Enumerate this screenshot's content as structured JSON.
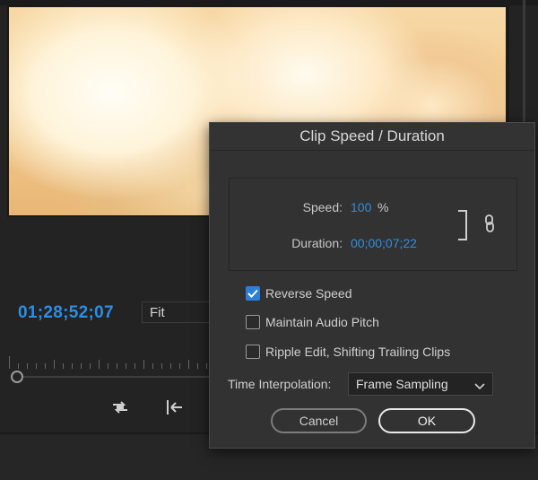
{
  "monitor": {
    "timecode": "01;28;52;07",
    "fit_label": "Fit"
  },
  "dialog": {
    "title": "Clip Speed / Duration",
    "speed_label": "Speed:",
    "speed_value": "100",
    "speed_unit": "%",
    "duration_label": "Duration:",
    "duration_value": "00;00;07;22",
    "options": [
      {
        "label": "Reverse Speed",
        "checked": true
      },
      {
        "label": "Maintain Audio Pitch",
        "checked": false
      },
      {
        "label": "Ripple Edit, Shifting Trailing Clips",
        "checked": false
      }
    ],
    "interpolation_label": "Time Interpolation:",
    "interpolation_value": "Frame Sampling",
    "cancel_label": "Cancel",
    "ok_label": "OK"
  },
  "colors": {
    "accent_blue": "#2d8fe5",
    "dialog_bg": "#323232",
    "app_bg": "#232323"
  },
  "icons": [
    "link-icon",
    "chevron-down-icon",
    "checkmark-icon",
    "loop-icon",
    "go-to-in-icon"
  ]
}
